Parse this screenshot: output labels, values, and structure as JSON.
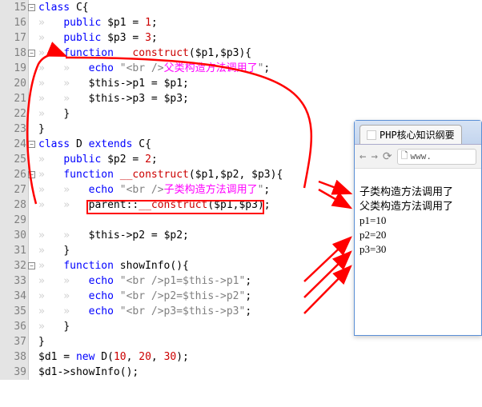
{
  "browser": {
    "tab_title": "PHP核心知识纲要",
    "url_prefix": "www.",
    "output": [
      "子类构造方法调用了",
      "父类构造方法调用了",
      "p1=10",
      "p2=20",
      "p3=30"
    ]
  },
  "code": {
    "lines": [
      {
        "n": 15,
        "fold": true,
        "seg": [
          [
            "kw",
            "class"
          ],
          [
            "op",
            " C{"
          ]
        ]
      },
      {
        "n": 16,
        "seg": [
          [
            "ws",
            "»   "
          ],
          [
            "kw",
            "public"
          ],
          [
            "op",
            " "
          ],
          [
            "var",
            "$p1"
          ],
          [
            "op",
            " = "
          ],
          [
            "num",
            "1"
          ],
          [
            "op",
            ";"
          ]
        ]
      },
      {
        "n": 17,
        "seg": [
          [
            "ws",
            "»   "
          ],
          [
            "kw",
            "public"
          ],
          [
            "op",
            " "
          ],
          [
            "var",
            "$p3"
          ],
          [
            "op",
            " = "
          ],
          [
            "num",
            "3"
          ],
          [
            "op",
            ";"
          ]
        ]
      },
      {
        "n": 18,
        "fold": true,
        "seg": [
          [
            "ws",
            "»   "
          ],
          [
            "kw",
            "function"
          ],
          [
            "op",
            " "
          ],
          [
            "magic",
            "__construct"
          ],
          [
            "op",
            "("
          ],
          [
            "var",
            "$p1"
          ],
          [
            "op",
            ","
          ],
          [
            "var",
            "$p3"
          ],
          [
            "op",
            "){"
          ]
        ]
      },
      {
        "n": 19,
        "seg": [
          [
            "ws",
            "»   »   "
          ],
          [
            "kw",
            "echo"
          ],
          [
            "op",
            " "
          ],
          [
            "str",
            "\"<br />"
          ],
          [
            "cjk",
            "父类构造方法调用了"
          ],
          [
            "str",
            "\""
          ],
          [
            "op",
            ";"
          ]
        ]
      },
      {
        "n": 20,
        "seg": [
          [
            "ws",
            "»   »   "
          ],
          [
            "var",
            "$this"
          ],
          [
            "op",
            "->"
          ],
          [
            "fn",
            "p1"
          ],
          [
            "op",
            " = "
          ],
          [
            "var",
            "$p1"
          ],
          [
            "op",
            ";"
          ]
        ]
      },
      {
        "n": 21,
        "seg": [
          [
            "ws",
            "»   »   "
          ],
          [
            "var",
            "$this"
          ],
          [
            "op",
            "->"
          ],
          [
            "fn",
            "p3"
          ],
          [
            "op",
            " = "
          ],
          [
            "var",
            "$p3"
          ],
          [
            "op",
            ";"
          ]
        ]
      },
      {
        "n": 22,
        "seg": [
          [
            "ws",
            "»   "
          ],
          [
            "op",
            "}"
          ]
        ]
      },
      {
        "n": 23,
        "seg": [
          [
            "op",
            "}"
          ]
        ]
      },
      {
        "n": 24,
        "fold": true,
        "seg": [
          [
            "kw",
            "class"
          ],
          [
            "op",
            " D "
          ],
          [
            "kw",
            "extends"
          ],
          [
            "op",
            " C{"
          ]
        ]
      },
      {
        "n": 25,
        "seg": [
          [
            "ws",
            "»   "
          ],
          [
            "kw",
            "public"
          ],
          [
            "op",
            " "
          ],
          [
            "var",
            "$p2"
          ],
          [
            "op",
            " = "
          ],
          [
            "num",
            "2"
          ],
          [
            "op",
            ";"
          ]
        ]
      },
      {
        "n": 26,
        "fold": true,
        "seg": [
          [
            "ws",
            "»   "
          ],
          [
            "kw",
            "function"
          ],
          [
            "op",
            " "
          ],
          [
            "magic",
            "__construct"
          ],
          [
            "op",
            "("
          ],
          [
            "var",
            "$p1"
          ],
          [
            "op",
            ","
          ],
          [
            "var",
            "$p2"
          ],
          [
            "op",
            ", "
          ],
          [
            "var",
            "$p3"
          ],
          [
            "op",
            "){"
          ]
        ]
      },
      {
        "n": 27,
        "seg": [
          [
            "ws",
            "»   »   "
          ],
          [
            "kw",
            "echo"
          ],
          [
            "op",
            " "
          ],
          [
            "str",
            "\"<br />"
          ],
          [
            "cjk",
            "子类构造方法调用了"
          ],
          [
            "str",
            "\""
          ],
          [
            "op",
            ";"
          ]
        ]
      },
      {
        "n": 28,
        "seg": [
          [
            "ws",
            "»   »   "
          ],
          [
            "parentcall",
            "parent::"
          ],
          [
            "magic",
            "__construct"
          ],
          [
            "op",
            "("
          ],
          [
            "var",
            "$p1"
          ],
          [
            "op",
            ","
          ],
          [
            "var",
            "$p3"
          ],
          [
            "op",
            ");"
          ]
        ]
      },
      {
        "n": 29,
        "seg": []
      },
      {
        "n": 30,
        "seg": [
          [
            "ws",
            "»   »   "
          ],
          [
            "var",
            "$this"
          ],
          [
            "op",
            "->"
          ],
          [
            "fn",
            "p2"
          ],
          [
            "op",
            " = "
          ],
          [
            "var",
            "$p2"
          ],
          [
            "op",
            ";"
          ]
        ]
      },
      {
        "n": 31,
        "seg": [
          [
            "ws",
            "»   "
          ],
          [
            "op",
            "}"
          ]
        ]
      },
      {
        "n": 32,
        "fold": true,
        "seg": [
          [
            "ws",
            "»   "
          ],
          [
            "kw",
            "function"
          ],
          [
            "op",
            " "
          ],
          [
            "fn",
            "showInfo"
          ],
          [
            "op",
            "(){"
          ]
        ]
      },
      {
        "n": 33,
        "seg": [
          [
            "ws",
            "»   »   "
          ],
          [
            "kw",
            "echo"
          ],
          [
            "op",
            " "
          ],
          [
            "str",
            "\"<br />p1=$this->p1\""
          ],
          [
            "op",
            ";"
          ]
        ]
      },
      {
        "n": 34,
        "seg": [
          [
            "ws",
            "»   »   "
          ],
          [
            "kw",
            "echo"
          ],
          [
            "op",
            " "
          ],
          [
            "str",
            "\"<br />p2=$this->p2\""
          ],
          [
            "op",
            ";"
          ]
        ]
      },
      {
        "n": 35,
        "seg": [
          [
            "ws",
            "»   »   "
          ],
          [
            "kw",
            "echo"
          ],
          [
            "op",
            " "
          ],
          [
            "str",
            "\"<br />p3=$this->p3\""
          ],
          [
            "op",
            ";"
          ]
        ]
      },
      {
        "n": 36,
        "seg": [
          [
            "ws",
            "»   "
          ],
          [
            "op",
            "}"
          ]
        ]
      },
      {
        "n": 37,
        "seg": [
          [
            "op",
            "}"
          ]
        ]
      },
      {
        "n": 38,
        "seg": [
          [
            "var",
            "$d1"
          ],
          [
            "op",
            " = "
          ],
          [
            "kw",
            "new"
          ],
          [
            "op",
            " D("
          ],
          [
            "num",
            "10"
          ],
          [
            "op",
            ", "
          ],
          [
            "num",
            "20"
          ],
          [
            "op",
            ", "
          ],
          [
            "num",
            "30"
          ],
          [
            "op",
            ");"
          ]
        ]
      },
      {
        "n": 39,
        "seg": [
          [
            "var",
            "$d1"
          ],
          [
            "op",
            "->"
          ],
          [
            "fn",
            "showInfo"
          ],
          [
            "op",
            "();"
          ]
        ]
      }
    ]
  }
}
